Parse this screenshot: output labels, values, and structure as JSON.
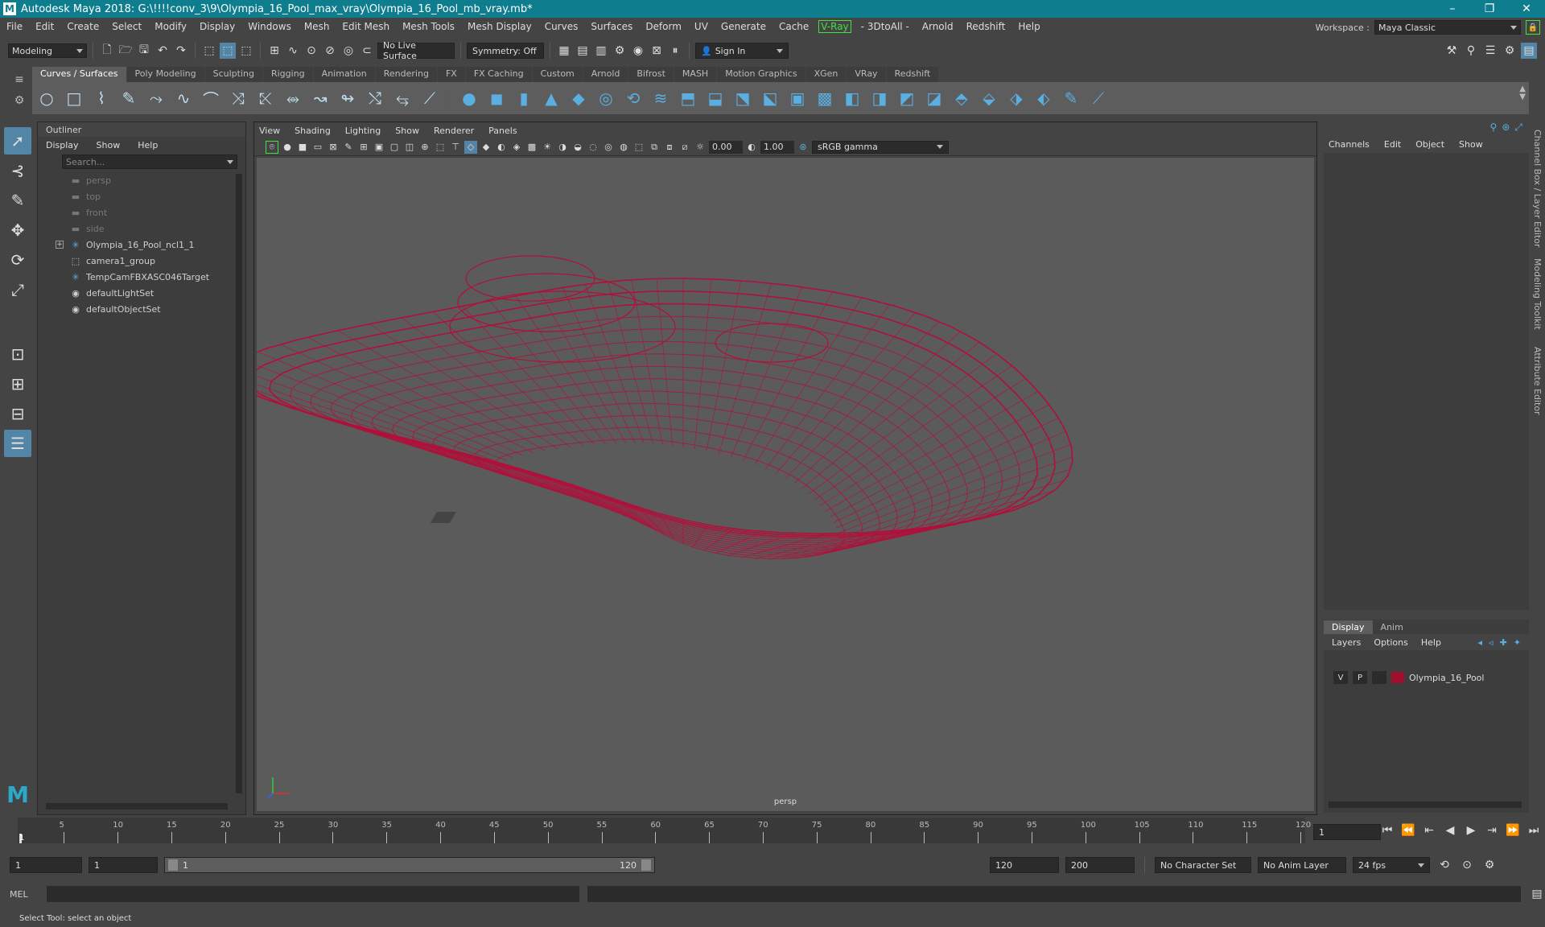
{
  "window": {
    "title": "Autodesk Maya 2018: G:\\!!!!conv_3\\9\\Olympia_16_Pool_max_vray\\Olympia_16_Pool_mb_vray.mb*",
    "logo": "M",
    "minimize": "–",
    "maximize": "❐",
    "close": "✕"
  },
  "menubar": {
    "items": [
      "File",
      "Edit",
      "Create",
      "Select",
      "Modify",
      "Display",
      "Windows",
      "Mesh",
      "Edit Mesh",
      "Mesh Tools",
      "Mesh Display",
      "Curves",
      "Surfaces",
      "Deform",
      "UV",
      "Generate",
      "Cache"
    ],
    "vray": "V-Ray",
    "items_after": [
      "- 3DtoAll -",
      "Arnold",
      "Redshift",
      "Help"
    ]
  },
  "workspace": {
    "label": "Workspace :",
    "value": "Maya Classic"
  },
  "statusline": {
    "mode": "Modeling",
    "live_surface": "No Live Surface",
    "symmetry": "Symmetry: Off",
    "sign_in": "Sign In"
  },
  "shelf": {
    "tabs": [
      "Curves / Surfaces",
      "Poly Modeling",
      "Sculpting",
      "Rigging",
      "Animation",
      "Rendering",
      "FX",
      "FX Caching",
      "Custom",
      "Arnold",
      "Bifrost",
      "MASH",
      "Motion Graphics",
      "XGen",
      "VRay",
      "Redshift"
    ],
    "active_tab": 0
  },
  "outliner": {
    "title": "Outliner",
    "menu": [
      "Display",
      "Show",
      "Help"
    ],
    "search_placeholder": "Search...",
    "items": [
      {
        "label": "persp",
        "icon": "camera-icon",
        "dim": true
      },
      {
        "label": "top",
        "icon": "camera-icon",
        "dim": true
      },
      {
        "label": "front",
        "icon": "camera-icon",
        "dim": true
      },
      {
        "label": "side",
        "icon": "camera-icon",
        "dim": true
      },
      {
        "label": "Olympia_16_Pool_ncl1_1",
        "icon": "transform-icon",
        "dim": false,
        "expand": "+"
      },
      {
        "label": "camera1_group",
        "icon": "group-icon",
        "dim": false
      },
      {
        "label": "TempCamFBXASC046Target",
        "icon": "transform-icon",
        "dim": false
      },
      {
        "label": "defaultLightSet",
        "icon": "set-icon",
        "dim": false
      },
      {
        "label": "defaultObjectSet",
        "icon": "set-icon",
        "dim": false
      }
    ]
  },
  "viewport": {
    "menu": [
      "View",
      "Shading",
      "Lighting",
      "Show",
      "Renderer",
      "Panels"
    ],
    "exposure": "0.00",
    "gamma": "1.00",
    "color_space": "sRGB gamma",
    "camera_label": "persp",
    "wire_color": "#b0103a"
  },
  "channelbox": {
    "menu": [
      "Channels",
      "Edit",
      "Object",
      "Show"
    ]
  },
  "layers": {
    "tabs": [
      "Display",
      "Anim"
    ],
    "menu": [
      "Layers",
      "Options",
      "Help"
    ],
    "row": {
      "v": "V",
      "p": "P",
      "name": "Olympia_16_Pool",
      "color": "#a0102c"
    }
  },
  "side_tabs": [
    "Channel Box / Layer Editor",
    "Modeling Toolkit",
    "Attribute Editor"
  ],
  "timeline": {
    "ticks": [
      5,
      10,
      15,
      20,
      25,
      30,
      35,
      40,
      45,
      50,
      55,
      60,
      65,
      70,
      75,
      80,
      85,
      90,
      95,
      100,
      105,
      110,
      115,
      120
    ],
    "current_frame": "1",
    "current_field": "1"
  },
  "range": {
    "start": "1",
    "playback_start": "1",
    "slider_start": "1",
    "slider_end": "120",
    "playback_end": "120",
    "end": "200",
    "character_set": "No Character Set",
    "anim_layer": "No Anim Layer",
    "fps": "24 fps"
  },
  "cmdline": {
    "label": "MEL"
  },
  "helpline": {
    "text": "Select Tool: select an object"
  }
}
